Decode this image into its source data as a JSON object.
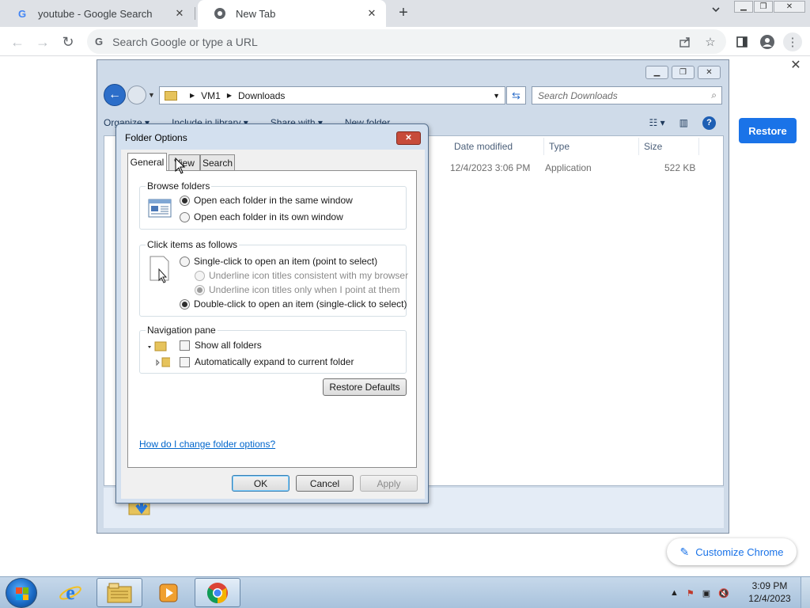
{
  "browser": {
    "tabs": [
      {
        "title": "youtube - Google Search",
        "favicon": "google-g-icon",
        "active": false
      },
      {
        "title": "New Tab",
        "favicon": "chrome-icon",
        "active": true
      }
    ],
    "omnibox_placeholder": "Search Google or type a URL",
    "restore_label": "Restore",
    "customize_label": "Customize Chrome"
  },
  "explorer": {
    "breadcrumb": [
      "VM1",
      "Downloads"
    ],
    "search_placeholder": "Search Downloads",
    "commands": [
      "Organize",
      "Include in library",
      "Share with",
      "New folder"
    ],
    "columns": [
      "Date modified",
      "Type",
      "Size"
    ],
    "file": {
      "date": "12/4/2023 3:06 PM",
      "type": "Application",
      "size": "522 KB"
    }
  },
  "dialog": {
    "title": "Folder Options",
    "tabs": [
      "General",
      "View",
      "Search"
    ],
    "browse": {
      "title": "Browse folders",
      "same_window": "Open each folder in the same window",
      "own_window": "Open each folder in its own window"
    },
    "click": {
      "title": "Click items as follows",
      "single": "Single-click to open an item (point to select)",
      "underline_browser": "Underline icon titles consistent with my browser",
      "underline_point": "Underline icon titles only when I point at them",
      "double": "Double-click to open an item (single-click to select)"
    },
    "nav": {
      "title": "Navigation pane",
      "show_all": "Show all folders",
      "auto_expand": "Automatically expand to current folder"
    },
    "restore_defaults": "Restore Defaults",
    "help_link": "How do I change folder options?",
    "ok": "OK",
    "cancel": "Cancel",
    "apply": "Apply"
  },
  "taskbar": {
    "time": "3:09 PM",
    "date": "12/4/2023"
  },
  "colors": {
    "chrome_blue": "#1a73e8",
    "link": "#0066cc"
  }
}
